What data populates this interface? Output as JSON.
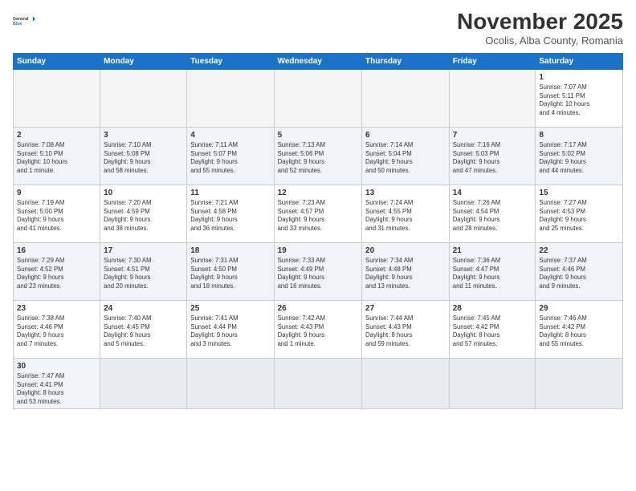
{
  "logo": {
    "text_general": "General",
    "text_blue": "Blue"
  },
  "header": {
    "month": "November 2025",
    "location": "Ocolis, Alba County, Romania"
  },
  "weekdays": [
    "Sunday",
    "Monday",
    "Tuesday",
    "Wednesday",
    "Thursday",
    "Friday",
    "Saturday"
  ],
  "weeks": [
    [
      {
        "day": null,
        "info": ""
      },
      {
        "day": null,
        "info": ""
      },
      {
        "day": null,
        "info": ""
      },
      {
        "day": null,
        "info": ""
      },
      {
        "day": null,
        "info": ""
      },
      {
        "day": null,
        "info": ""
      },
      {
        "day": "1",
        "info": "Sunrise: 7:07 AM\nSunset: 5:11 PM\nDaylight: 10 hours\nand 4 minutes."
      }
    ],
    [
      {
        "day": "2",
        "info": "Sunrise: 7:08 AM\nSunset: 5:10 PM\nDaylight: 10 hours\nand 1 minute."
      },
      {
        "day": "3",
        "info": "Sunrise: 7:10 AM\nSunset: 5:08 PM\nDaylight: 9 hours\nand 58 minutes."
      },
      {
        "day": "4",
        "info": "Sunrise: 7:11 AM\nSunset: 5:07 PM\nDaylight: 9 hours\nand 55 minutes."
      },
      {
        "day": "5",
        "info": "Sunrise: 7:13 AM\nSunset: 5:06 PM\nDaylight: 9 hours\nand 52 minutes."
      },
      {
        "day": "6",
        "info": "Sunrise: 7:14 AM\nSunset: 5:04 PM\nDaylight: 9 hours\nand 50 minutes."
      },
      {
        "day": "7",
        "info": "Sunrise: 7:16 AM\nSunset: 5:03 PM\nDaylight: 9 hours\nand 47 minutes."
      },
      {
        "day": "8",
        "info": "Sunrise: 7:17 AM\nSunset: 5:02 PM\nDaylight: 9 hours\nand 44 minutes."
      }
    ],
    [
      {
        "day": "9",
        "info": "Sunrise: 7:19 AM\nSunset: 5:00 PM\nDaylight: 9 hours\nand 41 minutes."
      },
      {
        "day": "10",
        "info": "Sunrise: 7:20 AM\nSunset: 4:59 PM\nDaylight: 9 hours\nand 38 minutes."
      },
      {
        "day": "11",
        "info": "Sunrise: 7:21 AM\nSunset: 4:58 PM\nDaylight: 9 hours\nand 36 minutes."
      },
      {
        "day": "12",
        "info": "Sunrise: 7:23 AM\nSunset: 4:57 PM\nDaylight: 9 hours\nand 33 minutes."
      },
      {
        "day": "13",
        "info": "Sunrise: 7:24 AM\nSunset: 4:55 PM\nDaylight: 9 hours\nand 31 minutes."
      },
      {
        "day": "14",
        "info": "Sunrise: 7:26 AM\nSunset: 4:54 PM\nDaylight: 9 hours\nand 28 minutes."
      },
      {
        "day": "15",
        "info": "Sunrise: 7:27 AM\nSunset: 4:53 PM\nDaylight: 9 hours\nand 25 minutes."
      }
    ],
    [
      {
        "day": "16",
        "info": "Sunrise: 7:29 AM\nSunset: 4:52 PM\nDaylight: 9 hours\nand 23 minutes."
      },
      {
        "day": "17",
        "info": "Sunrise: 7:30 AM\nSunset: 4:51 PM\nDaylight: 9 hours\nand 20 minutes."
      },
      {
        "day": "18",
        "info": "Sunrise: 7:31 AM\nSunset: 4:50 PM\nDaylight: 9 hours\nand 18 minutes."
      },
      {
        "day": "19",
        "info": "Sunrise: 7:33 AM\nSunset: 4:49 PM\nDaylight: 9 hours\nand 16 minutes."
      },
      {
        "day": "20",
        "info": "Sunrise: 7:34 AM\nSunset: 4:48 PM\nDaylight: 9 hours\nand 13 minutes."
      },
      {
        "day": "21",
        "info": "Sunrise: 7:36 AM\nSunset: 4:47 PM\nDaylight: 9 hours\nand 11 minutes."
      },
      {
        "day": "22",
        "info": "Sunrise: 7:37 AM\nSunset: 4:46 PM\nDaylight: 9 hours\nand 9 minutes."
      }
    ],
    [
      {
        "day": "23",
        "info": "Sunrise: 7:38 AM\nSunset: 4:46 PM\nDaylight: 9 hours\nand 7 minutes."
      },
      {
        "day": "24",
        "info": "Sunrise: 7:40 AM\nSunset: 4:45 PM\nDaylight: 9 hours\nand 5 minutes."
      },
      {
        "day": "25",
        "info": "Sunrise: 7:41 AM\nSunset: 4:44 PM\nDaylight: 9 hours\nand 3 minutes."
      },
      {
        "day": "26",
        "info": "Sunrise: 7:42 AM\nSunset: 4:43 PM\nDaylight: 9 hours\nand 1 minute."
      },
      {
        "day": "27",
        "info": "Sunrise: 7:44 AM\nSunset: 4:43 PM\nDaylight: 8 hours\nand 59 minutes."
      },
      {
        "day": "28",
        "info": "Sunrise: 7:45 AM\nSunset: 4:42 PM\nDaylight: 8 hours\nand 57 minutes."
      },
      {
        "day": "29",
        "info": "Sunrise: 7:46 AM\nSunset: 4:42 PM\nDaylight: 8 hours\nand 55 minutes."
      }
    ],
    [
      {
        "day": "30",
        "info": "Sunrise: 7:47 AM\nSunset: 4:41 PM\nDaylight: 8 hours\nand 53 minutes."
      },
      {
        "day": null,
        "info": ""
      },
      {
        "day": null,
        "info": ""
      },
      {
        "day": null,
        "info": ""
      },
      {
        "day": null,
        "info": ""
      },
      {
        "day": null,
        "info": ""
      },
      {
        "day": null,
        "info": ""
      }
    ]
  ]
}
